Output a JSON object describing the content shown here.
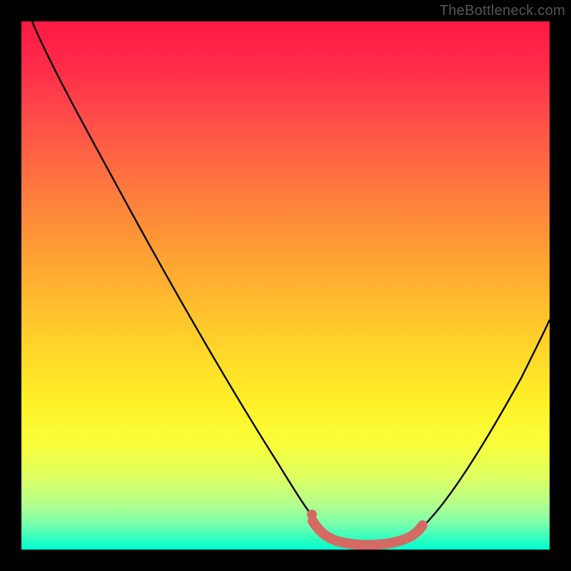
{
  "watermark": "TheBottleneck.com",
  "chart_data": {
    "type": "line",
    "title": "",
    "xlabel": "",
    "ylabel": "",
    "xlim": [
      0,
      100
    ],
    "ylim": [
      0,
      100
    ],
    "series": [
      {
        "name": "curve",
        "x": [
          2,
          8,
          16,
          24,
          32,
          40,
          48,
          54,
          58,
          62,
          66,
          70,
          74,
          78,
          84,
          90,
          96,
          100
        ],
        "y": [
          100,
          92,
          82,
          71,
          60,
          48,
          36,
          24,
          14,
          6,
          2,
          2,
          2,
          4,
          12,
          24,
          40,
          52
        ]
      }
    ],
    "highlight_segment": {
      "x": [
        54,
        58,
        62,
        66,
        70,
        74
      ],
      "y": [
        8,
        4,
        2,
        2,
        3,
        6
      ]
    },
    "gradient_stops": [
      {
        "pos": 0,
        "color": "#ff1944"
      },
      {
        "pos": 50,
        "color": "#ffd02a"
      },
      {
        "pos": 100,
        "color": "#00ffcf"
      }
    ]
  }
}
